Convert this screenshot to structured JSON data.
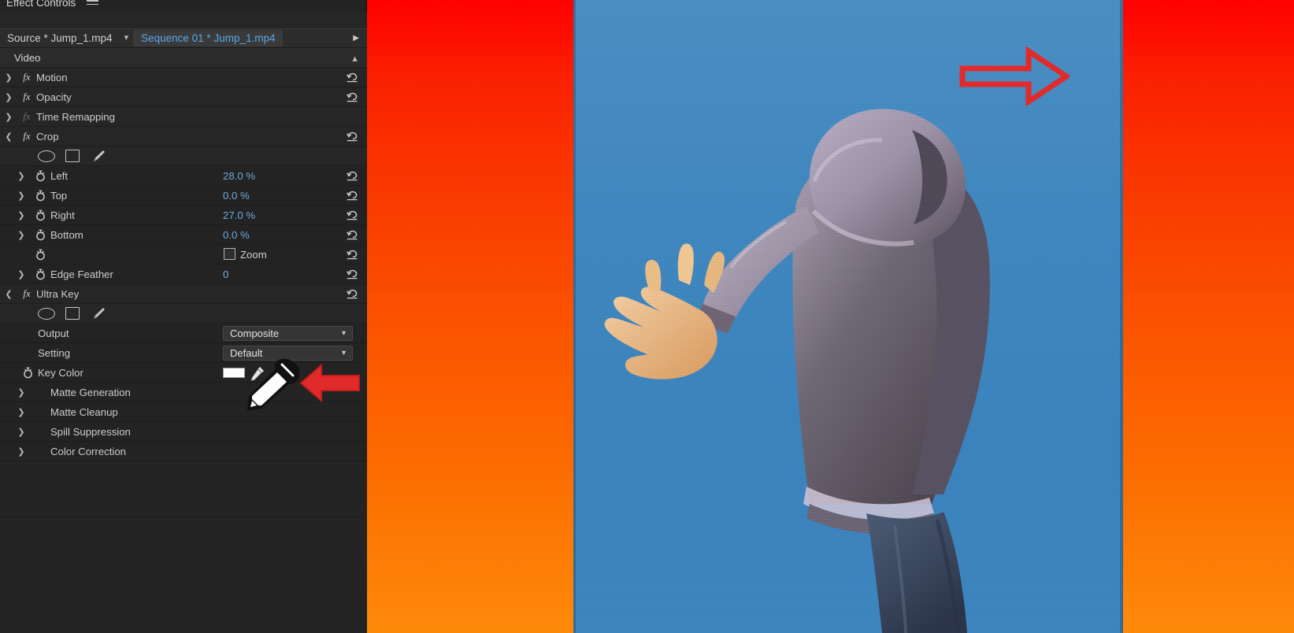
{
  "app": {
    "panel_title": "Effect Controls",
    "menu_icon": "hamburger-icon"
  },
  "tabs": {
    "source_label": "Source * Jump_1.mp4",
    "chevron_icon": "chevron-down-icon",
    "sequence_label": "Sequence 01 * Jump_1.mp4",
    "play_icon": "play-triangle-icon",
    "active": "sequence"
  },
  "groups": {
    "video_label": "Video",
    "video_collapse_icon": "chevron-up-icon"
  },
  "effects": [
    {
      "name": "Motion",
      "expanded": false,
      "enabled": true,
      "has_reset": true,
      "disclosure": "chevron-right-icon"
    },
    {
      "name": "Opacity",
      "expanded": false,
      "enabled": true,
      "has_reset": true,
      "disclosure": "chevron-right-icon"
    },
    {
      "name": "Time Remapping",
      "expanded": false,
      "enabled": false,
      "has_reset": false,
      "disclosure": "chevron-right-icon"
    },
    {
      "name": "Crop",
      "expanded": true,
      "enabled": true,
      "has_reset": true,
      "disclosure": "chevron-down-icon"
    },
    {
      "name": "Ultra Key",
      "expanded": true,
      "enabled": true,
      "has_reset": true,
      "disclosure": "chevron-down-icon"
    }
  ],
  "mask_tools": {
    "ellipse_icon": "ellipse-mask-icon",
    "rectangle_icon": "rectangle-mask-icon",
    "pen_icon": "pen-mask-icon"
  },
  "crop_params": [
    {
      "label": "Left",
      "value": "28.0 %",
      "disclosure": "chevron-right-icon",
      "stopwatch": "stopwatch-icon",
      "reset": true
    },
    {
      "label": "Top",
      "value": "0.0 %",
      "disclosure": "chevron-right-icon",
      "stopwatch": "stopwatch-icon",
      "reset": true
    },
    {
      "label": "Right",
      "value": "27.0 %",
      "disclosure": "chevron-right-icon",
      "stopwatch": "stopwatch-icon",
      "reset": true
    },
    {
      "label": "Bottom",
      "value": "0.0 %",
      "disclosure": "chevron-right-icon",
      "stopwatch": "stopwatch-icon",
      "reset": true
    }
  ],
  "crop_zoom": {
    "checkbox_label": "Zoom",
    "checked": false,
    "stopwatch": "stopwatch-icon",
    "reset": true
  },
  "crop_feather": {
    "label": "Edge Feather",
    "value": "0",
    "disclosure": "chevron-right-icon",
    "stopwatch": "stopwatch-icon",
    "reset": true
  },
  "ultra_key": {
    "output": {
      "label": "Output",
      "value": "Composite",
      "chevron_icon": "chevron-down-icon"
    },
    "setting": {
      "label": "Setting",
      "value": "Default",
      "chevron_icon": "chevron-down-icon"
    },
    "key_color": {
      "label": "Key Color",
      "swatch_color": "#ffffff",
      "eyedropper_icon": "eyedropper-icon",
      "stopwatch": "stopwatch-icon"
    },
    "sections": [
      {
        "label": "Matte Generation",
        "disclosure": "chevron-right-icon"
      },
      {
        "label": "Matte Cleanup",
        "disclosure": "chevron-right-icon"
      },
      {
        "label": "Spill Suppression",
        "disclosure": "chevron-right-icon"
      },
      {
        "label": "Color Correction",
        "disclosure": "chevron-right-icon"
      }
    ]
  },
  "monitor": {
    "background_top_color": "#ff0000",
    "background_bottom_color": "#fe8a0a",
    "clip_background_color": "#3f87bf",
    "subject_description": "person in grey hoodie with outstretched arm on blue screen"
  },
  "annotations": [
    {
      "name": "arrow-top",
      "direction": "right",
      "color": "#e12b2b"
    },
    {
      "name": "arrow-keycolor",
      "direction": "left",
      "color": "#e12b2b"
    }
  ],
  "cursor": {
    "type": "eyedropper-cursor"
  }
}
